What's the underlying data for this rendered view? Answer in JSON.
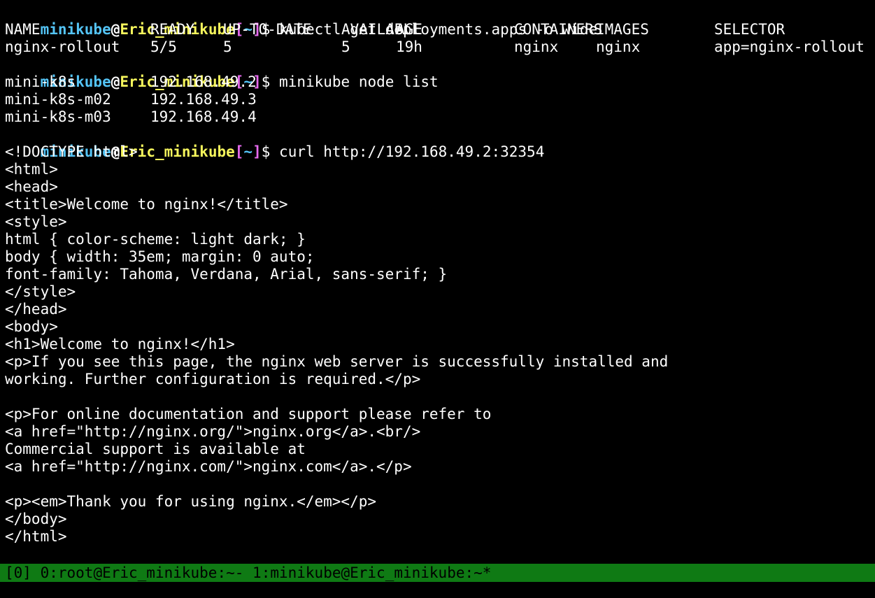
{
  "prompt": {
    "user": "minikube",
    "at": "@",
    "host": "Eric_minikube",
    "open_bracket": "[",
    "path": "~",
    "close_bracket": "]",
    "dollar": "$"
  },
  "commands": {
    "cmd1": "kubectl get deployments.apps -o wide",
    "cmd2": "minikube node list",
    "cmd3": "curl http://192.168.49.2:32354"
  },
  "deployments_table": {
    "headers": [
      "NAME",
      "READY",
      "UP-TO-DATE",
      "AVAILABLE",
      "AGE",
      "CONTAINERS",
      "IMAGES",
      "SELECTOR"
    ],
    "rows": [
      [
        "nginx-rollout",
        "5/5",
        "5",
        "5",
        "19h",
        "nginx",
        "nginx",
        "app=nginx-rollout"
      ]
    ]
  },
  "nodes": [
    {
      "name": "mini-k8s",
      "ip": "192.168.49.2"
    },
    {
      "name": "mini-k8s-m02",
      "ip": "192.168.49.3"
    },
    {
      "name": "mini-k8s-m03",
      "ip": "192.168.49.4"
    }
  ],
  "curl_output": [
    "<!DOCTYPE html>",
    "<html>",
    "<head>",
    "<title>Welcome to nginx!</title>",
    "<style>",
    "html { color-scheme: light dark; }",
    "body { width: 35em; margin: 0 auto;",
    "font-family: Tahoma, Verdana, Arial, sans-serif; }",
    "</style>",
    "</head>",
    "<body>",
    "<h1>Welcome to nginx!</h1>",
    "<p>If you see this page, the nginx web server is successfully installed and",
    "working. Further configuration is required.</p>",
    "",
    "<p>For online documentation and support please refer to",
    "<a href=\"http://nginx.org/\">nginx.org</a>.<br/>",
    "Commercial support is available at",
    "<a href=\"http://nginx.com/\">nginx.com</a>.</p>",
    "",
    "<p><em>Thank you for using nginx.</em></p>",
    "</body>",
    "</html>"
  ],
  "statusbar": {
    "session": "[0]",
    "window0": "0:root@Eric_minikube:~-",
    "window1": "1:minikube@Eric_minikube:~*"
  },
  "colors": {
    "background": "#000000",
    "prompt_user": "#54c4f6",
    "prompt_host": "#f5f55c",
    "prompt_bracket": "#e86cf0",
    "cursor": "#2ed62e",
    "statusbar_bg": "#0f7a14"
  }
}
